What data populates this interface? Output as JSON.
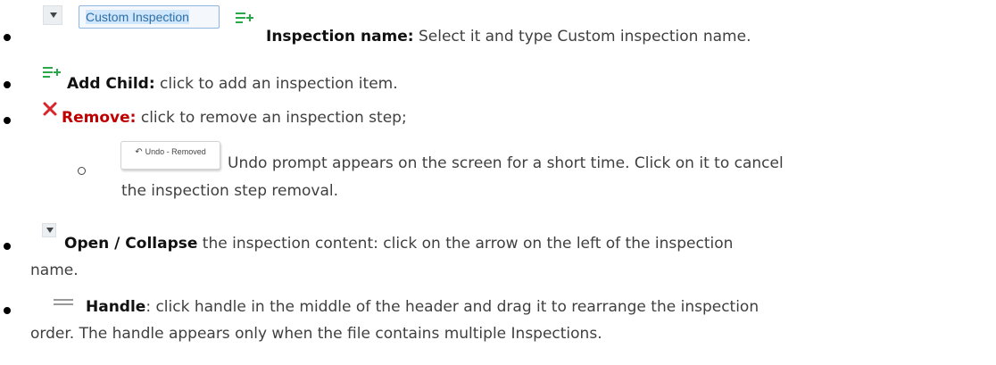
{
  "items": [
    {
      "name_box_text": "Custom Inspection",
      "term": "Inspection name:",
      "desc": " Select it and type Custom inspection name."
    },
    {
      "term": "Add Child:",
      "desc": " click to add an inspection item."
    },
    {
      "term": "Remove:",
      "desc": " click to remove an inspection step;"
    },
    {
      "undo_button_label": "Undo - Removed",
      "desc_line1": "Undo prompt appears on the screen for a short time. Click on it to cancel",
      "desc_line2": "the inspection step removal."
    },
    {
      "term": "Open / Collapse",
      "desc_line1": " the inspection content: click on the arrow on the left of the inspection",
      "desc_line2": "name."
    },
    {
      "term": "Handle",
      "desc_line1": ": click handle in the middle of the header and drag it to rearrange the inspection",
      "desc_line2": "order. The handle appears only when the file contains multiple Inspections."
    }
  ],
  "icons": {
    "collapse": "chevron-down-icon",
    "add_child": "add-child-icon",
    "remove": "close-icon",
    "undo": "undo-icon",
    "handle": "drag-handle-icon"
  },
  "colors": {
    "add_child_green": "#2aa84a",
    "remove_red": "#d9262a",
    "name_box_border": "#8fb7df",
    "name_box_text": "#2d6fa8"
  }
}
